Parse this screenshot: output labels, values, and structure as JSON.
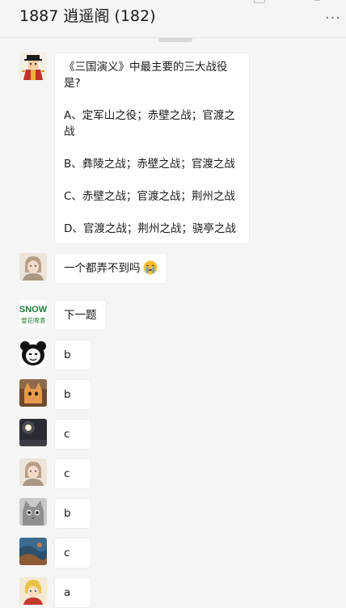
{
  "header": {
    "title": "1887 逍遥阁 (182)",
    "more_label": "···"
  },
  "messages": [
    {
      "avatar": "user-avatar-traditional-costume",
      "paragraphs": [
        "《三国演义》中最主要的三大战役是?",
        "A、定军山之役；赤壁之战；官渡之战",
        "B、彝陵之战；赤壁之战；官渡之战",
        "C、赤壁之战；官渡之战；荆州之战",
        "D、官渡之战；荆州之战；骁亭之战"
      ]
    },
    {
      "avatar": "user-avatar-portrait-girl",
      "text": "一个都弄不到吗",
      "emoji": "crying-face-icon"
    },
    {
      "avatar": "user-avatar-snow-logo",
      "avatar_text_top": "SNOW",
      "avatar_text_bottom": "雪花啤酒",
      "text": "下一题"
    },
    {
      "avatar": "user-avatar-panda-meme",
      "text": "b"
    },
    {
      "avatar": "user-avatar-cat-orange",
      "text": "b"
    },
    {
      "avatar": "user-avatar-night-light",
      "text": "c"
    },
    {
      "avatar": "user-avatar-portrait-girl",
      "text": "c"
    },
    {
      "avatar": "user-avatar-cat-grey",
      "text": "b"
    },
    {
      "avatar": "user-avatar-landscape",
      "text": "c"
    },
    {
      "avatar": "user-avatar-cartoon-character",
      "text": "a"
    }
  ],
  "colors": {
    "background": "#f5f5f5",
    "bubble": "#ffffff",
    "bubble_border": "#ededed",
    "text": "#191919"
  }
}
